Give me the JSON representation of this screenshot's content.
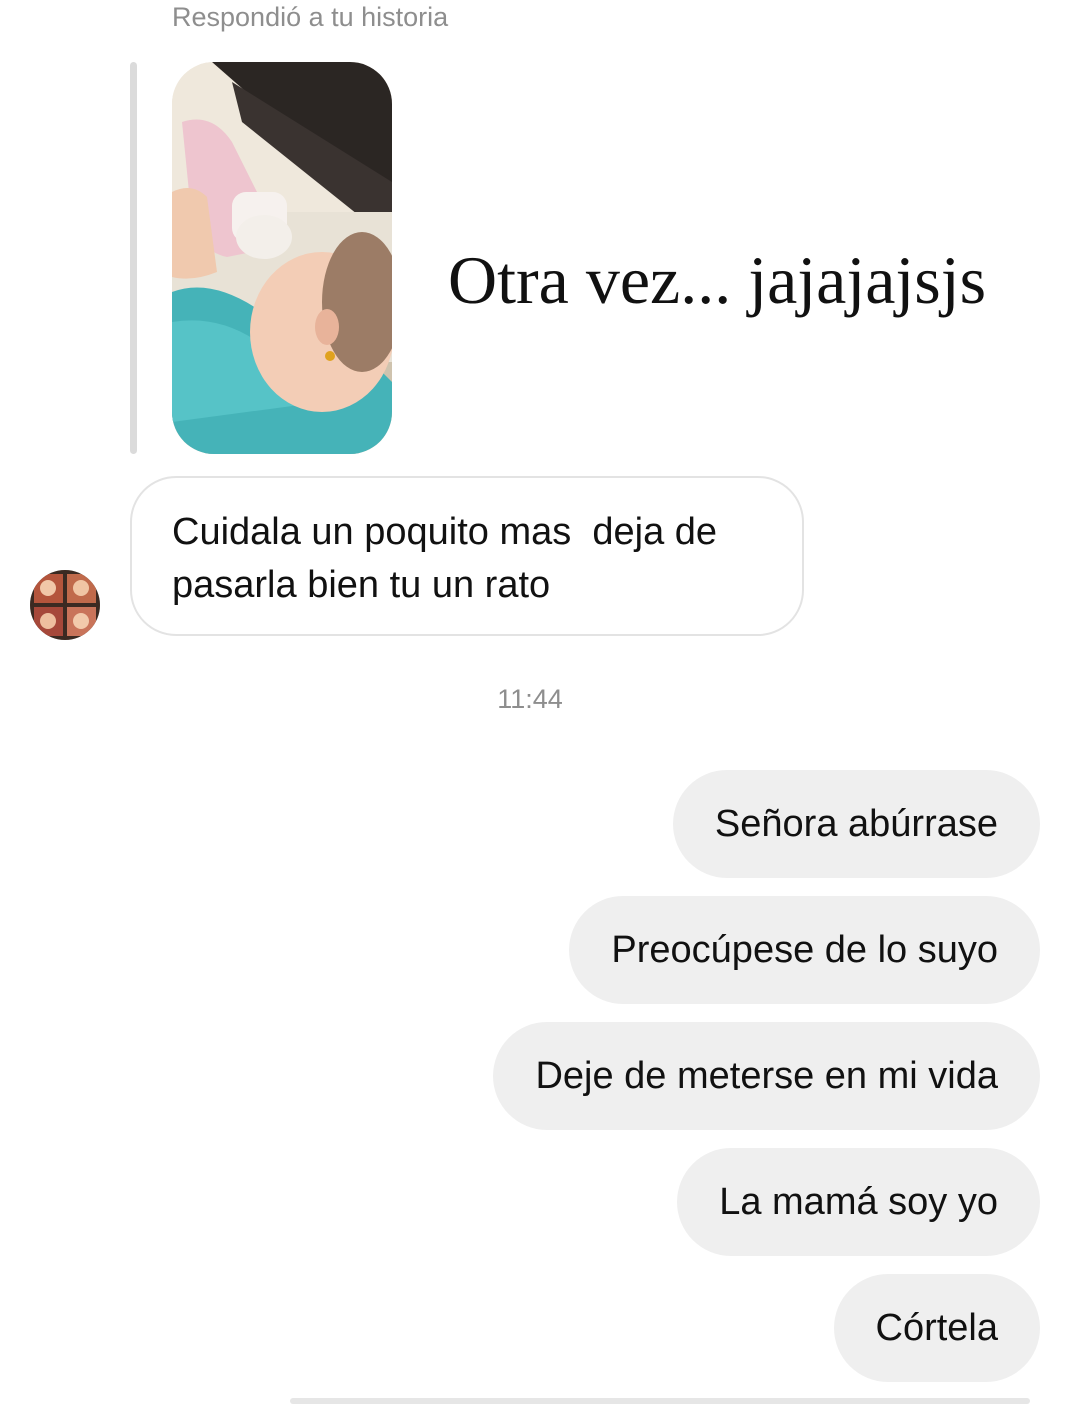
{
  "story_reply": {
    "label": "Respondió a tu historia",
    "thumbnail_caption": "Otra vez... jajajajsjs"
  },
  "incoming_message": {
    "text": "Cuidala un poquito mas  deja de\npasarla bien tu un rato"
  },
  "timestamp": "11:44",
  "outgoing_messages": [
    {
      "text": "Señora abúrrase"
    },
    {
      "text": "Preocúpese de lo suyo"
    },
    {
      "text": "Deje de meterse en mi vida"
    },
    {
      "text": "La mamá soy yo"
    },
    {
      "text": "Córtela"
    }
  ],
  "colors": {
    "outgoing_bubble": "#efefef",
    "incoming_border": "#e3e3e3",
    "secondary_text": "#8e8e8e"
  }
}
